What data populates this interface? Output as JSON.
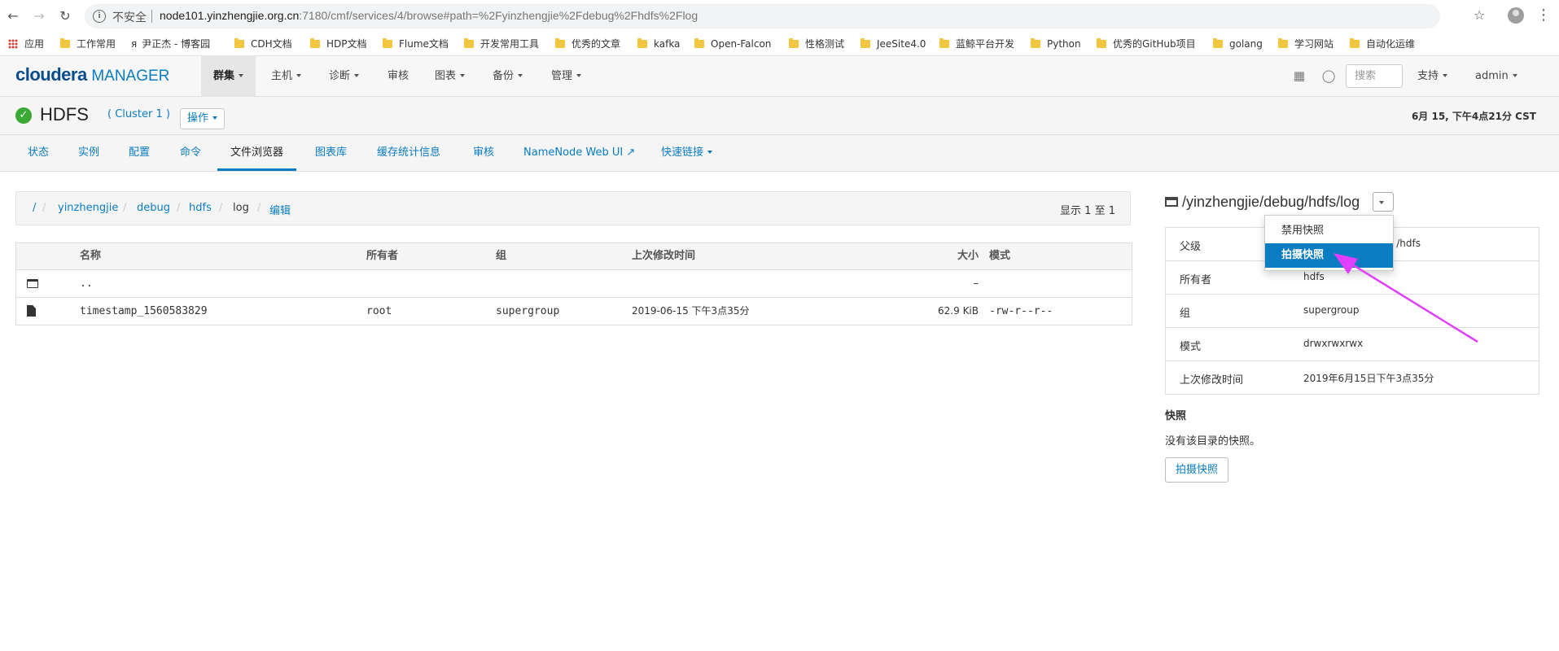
{
  "browser": {
    "insecure_label": "不安全",
    "url_host": "node101.yinzhengjie.org.cn",
    "url_rest": ":7180/cmf/services/4/browse#path=%2Fyinzhengjie%2Fdebug%2Fhdfs%2Flog",
    "bookmarks": [
      "应用",
      "工作常用",
      "尹正杰 - 博客园",
      "CDH文档",
      "HDP文档",
      "Flume文档",
      "开发常用工具",
      "优秀的文章",
      "kafka",
      "Open-Falcon",
      "性格测试",
      "JeeSite4.0",
      "蓝鲸平台开发",
      "Python",
      "优秀的GitHub项目",
      "golang",
      "学习网站",
      "自动化运维"
    ]
  },
  "header": {
    "logo_brand": "cloudera",
    "logo_product": "MANAGER",
    "nav": [
      "群集",
      "主机",
      "诊断",
      "审核",
      "图表",
      "备份",
      "管理"
    ],
    "search_placeholder": "搜索",
    "support": "支持",
    "user": "admin"
  },
  "service": {
    "name": "HDFS",
    "cluster": "( Cluster 1 )",
    "actions": "操作",
    "datetime": "6月 15, 下午4点21分 CST"
  },
  "tabs": [
    "状态",
    "实例",
    "配置",
    "命令",
    "文件浏览器",
    "图表库",
    "缓存统计信息",
    "审核",
    "NameNode Web UI",
    "快速链接"
  ],
  "breadcrumb": {
    "root": "/",
    "parts": [
      "yinzhengjie",
      "debug",
      "hdfs",
      "log"
    ],
    "edit": "编辑",
    "showing": "显示 1 至 1"
  },
  "file_table": {
    "headers": [
      "名称",
      "所有者",
      "组",
      "上次修改时间",
      "大小",
      "模式"
    ],
    "rows": [
      {
        "name": "..",
        "owner": "",
        "group": "",
        "mtime": "",
        "size": "–",
        "mode": ""
      },
      {
        "name": "timestamp_1560583829",
        "owner": "root",
        "group": "supergroup",
        "mtime": "2019-06-15 下午3点35分",
        "size": "62.9 KiB",
        "mode": "-rw-r--r--"
      }
    ]
  },
  "right_panel": {
    "path": "/yinzhengjie/debug/hdfs/log",
    "dropdown": [
      "禁用快照",
      "拍摄快照"
    ],
    "props": [
      {
        "key": "父级",
        "value": "/hdfs"
      },
      {
        "key": "所有者",
        "value": "hdfs"
      },
      {
        "key": "组",
        "value": "supergroup"
      },
      {
        "key": "模式",
        "value": "drwxrwxrwx"
      },
      {
        "key": "上次修改时间",
        "value": "2019年6月15日下午3点35分"
      }
    ],
    "snapshots_title": "快照",
    "snapshots_none": "没有该目录的快照。",
    "snapshot_button": "拍摄快照"
  },
  "colors": {
    "accent": "#0a7cc2",
    "ok": "#3aaa35",
    "annotation_arrow": "#e040fb"
  }
}
